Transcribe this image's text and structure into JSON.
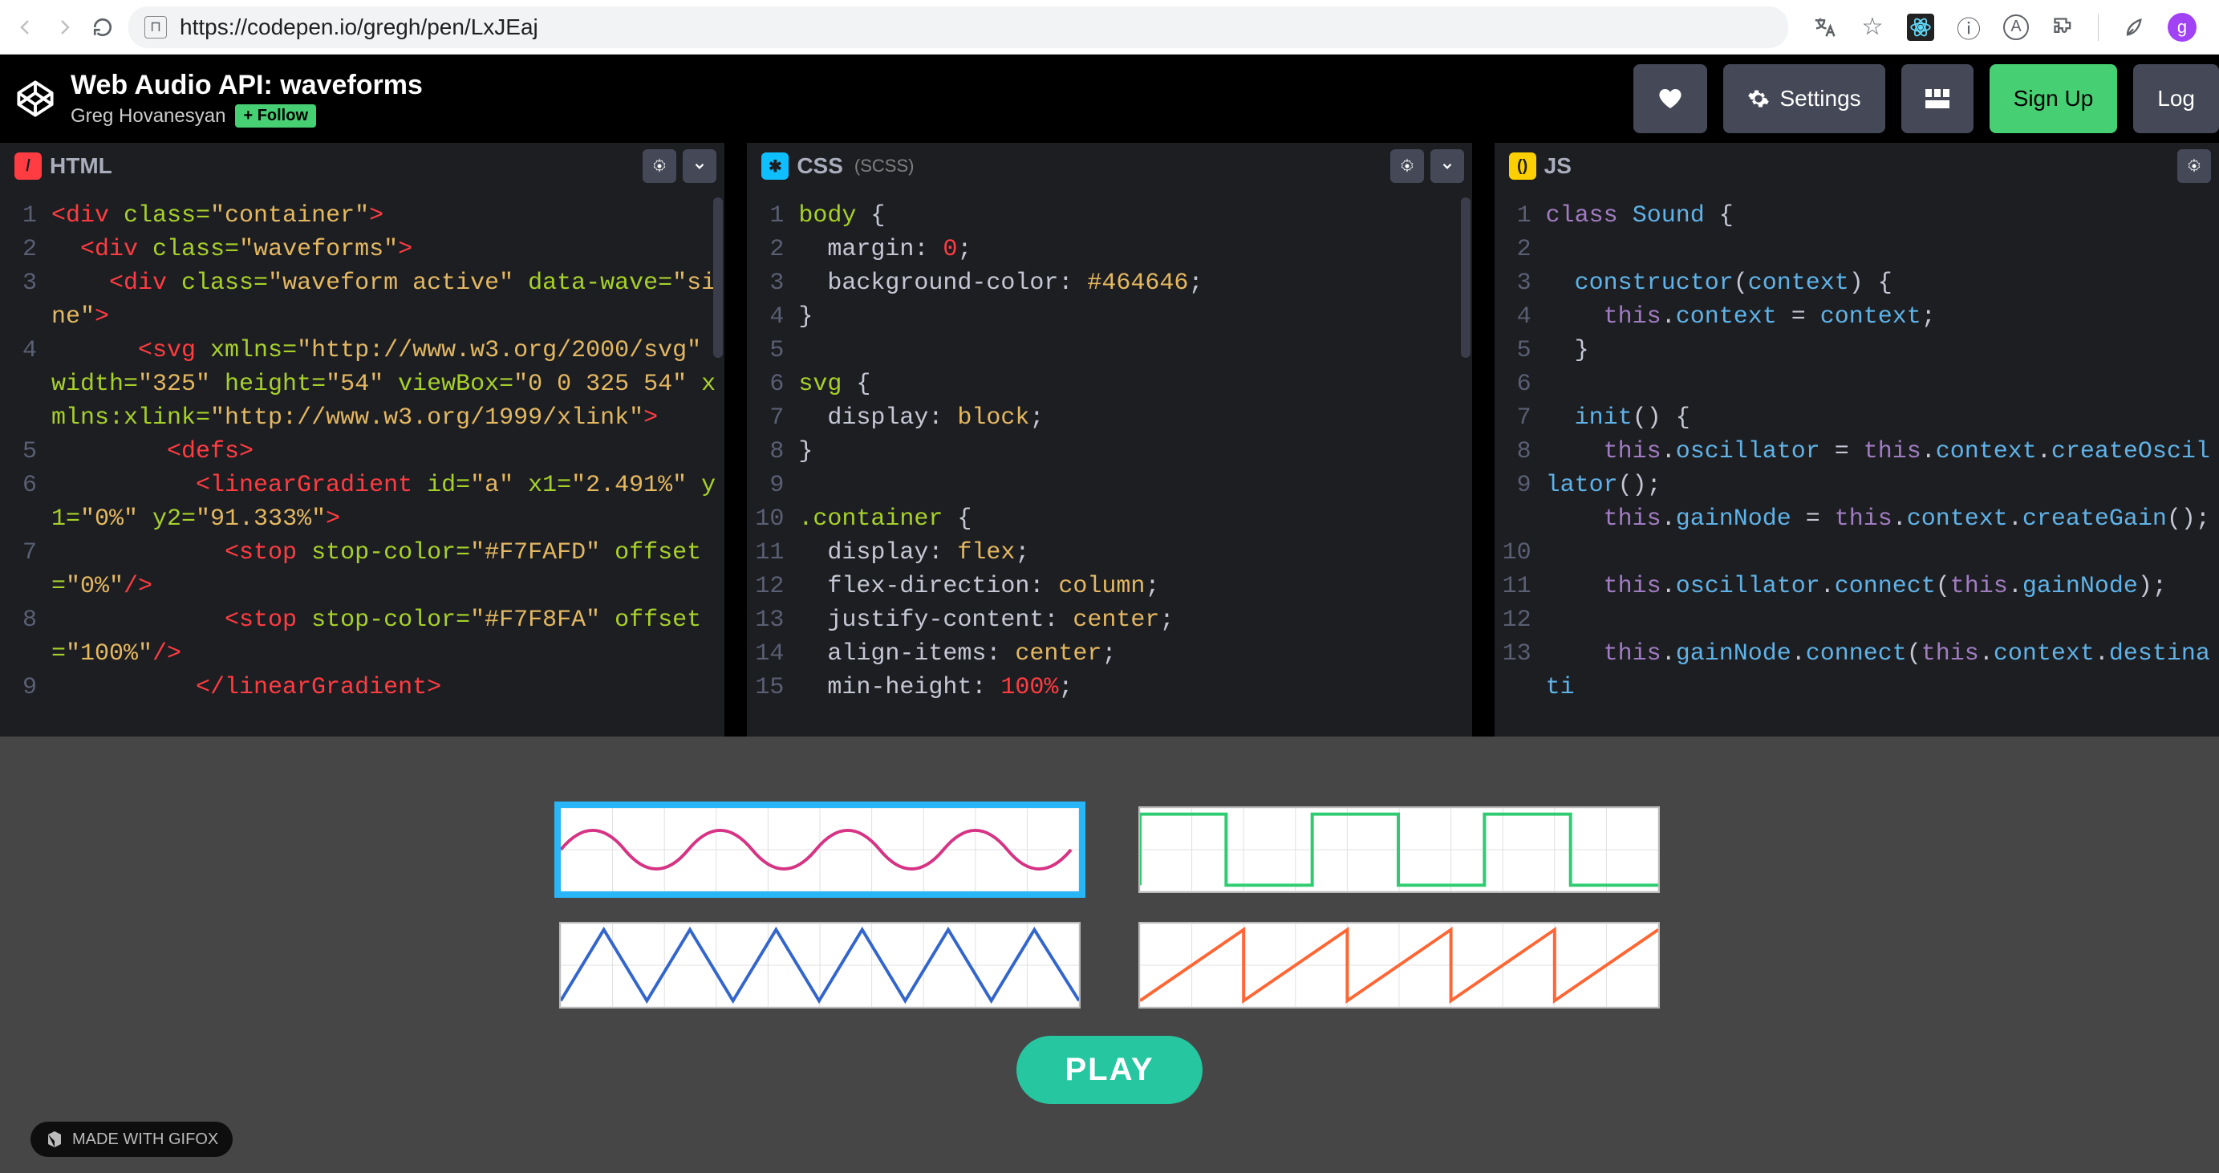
{
  "browser": {
    "url": "https://codepen.io/gregh/pen/LxJEaj",
    "avatar_initial": "g",
    "icons": [
      "translate-icon",
      "star-icon",
      "react-devtools-icon",
      "info-icon",
      "font-icon",
      "extensions-icon",
      "divider",
      "leaf-icon"
    ]
  },
  "header": {
    "title": "Web Audio API: waveforms",
    "author": "Greg Hovanesyan",
    "follow_label": "+ Follow",
    "settings_label": "Settings",
    "signup_label": "Sign Up",
    "login_label": "Log"
  },
  "editors": {
    "html": {
      "label": "HTML",
      "sublabel": "",
      "gutter": "1\n2\n3\n\n4\n\n\n5\n6\n\n7\n\n8\n\n9",
      "code_tokens": [
        [
          "tag",
          "<div"
        ],
        [
          "attr",
          " class="
        ],
        [
          "str",
          "\"container\""
        ],
        [
          "tag",
          ">"
        ],
        [
          "",
          "\n"
        ],
        [
          "",
          "  "
        ],
        [
          "tag",
          "<div"
        ],
        [
          "attr",
          " class="
        ],
        [
          "str",
          "\"waveforms\""
        ],
        [
          "tag",
          ">"
        ],
        [
          "",
          "\n"
        ],
        [
          "",
          "    "
        ],
        [
          "tag",
          "<div"
        ],
        [
          "attr",
          " class="
        ],
        [
          "str",
          "\"waveform active\""
        ],
        [
          "attr",
          " data-wave="
        ],
        [
          "str",
          "\"sine\""
        ],
        [
          "tag",
          ">"
        ],
        [
          "",
          "\n"
        ],
        [
          "",
          "      "
        ],
        [
          "tag",
          "<svg"
        ],
        [
          "attr",
          " xmlns="
        ],
        [
          "str",
          "\"http://www.w3.org/2000/svg\""
        ],
        [
          "attr",
          " width="
        ],
        [
          "str",
          "\"325\""
        ],
        [
          "attr",
          " height="
        ],
        [
          "str",
          "\"54\""
        ],
        [
          "attr",
          " viewBox="
        ],
        [
          "str",
          "\"0 0 325 54\""
        ],
        [
          "attr",
          " xmlns:xlink="
        ],
        [
          "str",
          "\"http://www.w3.org/1999/xlink\""
        ],
        [
          "tag",
          ">"
        ],
        [
          "",
          "\n"
        ],
        [
          "",
          "        "
        ],
        [
          "tag",
          "<defs>"
        ],
        [
          "",
          "\n"
        ],
        [
          "",
          "          "
        ],
        [
          "tag",
          "<linearGradient"
        ],
        [
          "attr",
          " id="
        ],
        [
          "str",
          "\"a\""
        ],
        [
          "attr",
          " x1="
        ],
        [
          "str",
          "\"2.491%\""
        ],
        [
          "attr",
          " y1="
        ],
        [
          "str",
          "\"0%\""
        ],
        [
          "attr",
          " y2="
        ],
        [
          "str",
          "\"91.333%\""
        ],
        [
          "tag",
          ">"
        ],
        [
          "",
          "\n"
        ],
        [
          "",
          "            "
        ],
        [
          "tag",
          "<stop"
        ],
        [
          "attr",
          " stop-color="
        ],
        [
          "str",
          "\"#F7FAFD\""
        ],
        [
          "attr",
          " offset="
        ],
        [
          "str",
          "\"0%\""
        ],
        [
          "tag",
          "/>"
        ],
        [
          "",
          "\n"
        ],
        [
          "",
          "            "
        ],
        [
          "tag",
          "<stop"
        ],
        [
          "attr",
          " stop-color="
        ],
        [
          "str",
          "\"#F7F8FA\""
        ],
        [
          "attr",
          " offset="
        ],
        [
          "str",
          "\"100%\""
        ],
        [
          "tag",
          "/>"
        ],
        [
          "",
          "\n"
        ],
        [
          "",
          "          "
        ],
        [
          "tag",
          "</linearGradient>"
        ]
      ]
    },
    "css": {
      "label": "CSS",
      "sublabel": "(SCSS)",
      "gutter": "1\n2\n3\n4\n5\n6\n7\n8\n9\n10\n11\n12\n13\n14\n15",
      "code_tokens": [
        [
          "sel",
          "body"
        ],
        [
          "",
          " {\n"
        ],
        [
          "",
          "  "
        ],
        [
          "prop",
          "margin"
        ],
        [
          "",
          ": "
        ],
        [
          "num",
          "0"
        ],
        [
          "",
          ";\n"
        ],
        [
          "",
          "  "
        ],
        [
          "prop",
          "background-color"
        ],
        [
          "",
          ": "
        ],
        [
          "val",
          "#464646"
        ],
        [
          "",
          ";\n"
        ],
        [
          "",
          "}\n\n"
        ],
        [
          "sel",
          "svg"
        ],
        [
          "",
          " {\n"
        ],
        [
          "",
          "  "
        ],
        [
          "prop",
          "display"
        ],
        [
          "",
          ": "
        ],
        [
          "val",
          "block"
        ],
        [
          "",
          ";\n"
        ],
        [
          "",
          "}\n\n"
        ],
        [
          "sel",
          ".container"
        ],
        [
          "",
          " {\n"
        ],
        [
          "",
          "  "
        ],
        [
          "prop",
          "display"
        ],
        [
          "",
          ": "
        ],
        [
          "val",
          "flex"
        ],
        [
          "",
          ";\n"
        ],
        [
          "",
          "  "
        ],
        [
          "prop",
          "flex-direction"
        ],
        [
          "",
          ": "
        ],
        [
          "val",
          "column"
        ],
        [
          "",
          ";\n"
        ],
        [
          "",
          "  "
        ],
        [
          "prop",
          "justify-content"
        ],
        [
          "",
          ": "
        ],
        [
          "val",
          "center"
        ],
        [
          "",
          ";\n"
        ],
        [
          "",
          "  "
        ],
        [
          "prop",
          "align-items"
        ],
        [
          "",
          ": "
        ],
        [
          "val",
          "center"
        ],
        [
          "",
          ";\n"
        ],
        [
          "",
          "  "
        ],
        [
          "prop",
          "min-height"
        ],
        [
          "",
          ": "
        ],
        [
          "num",
          "100%"
        ],
        [
          "",
          ";"
        ]
      ]
    },
    "js": {
      "label": "JS",
      "sublabel": "",
      "gutter": "1\n2\n3\n4\n5\n6\n7\n8\n9\n\n10\n11\n12\n13",
      "code_tokens": [
        [
          "kw",
          "class"
        ],
        [
          "",
          " "
        ],
        [
          "id",
          "Sound"
        ],
        [
          "",
          " {\n\n"
        ],
        [
          "",
          "  "
        ],
        [
          "fn",
          "constructor"
        ],
        [
          "",
          "("
        ],
        [
          "id",
          "context"
        ],
        [
          "",
          ") {\n"
        ],
        [
          "",
          "    "
        ],
        [
          "kw",
          "this"
        ],
        [
          "",
          "."
        ],
        [
          "id",
          "context"
        ],
        [
          "",
          " = "
        ],
        [
          "id",
          "context"
        ],
        [
          "",
          ";\n"
        ],
        [
          "",
          "  }\n\n"
        ],
        [
          "",
          "  "
        ],
        [
          "fn",
          "init"
        ],
        [
          "",
          "() {\n"
        ],
        [
          "",
          "    "
        ],
        [
          "kw",
          "this"
        ],
        [
          "",
          "."
        ],
        [
          "id",
          "oscillator"
        ],
        [
          "",
          " = "
        ],
        [
          "kw",
          "this"
        ],
        [
          "",
          "."
        ],
        [
          "id",
          "context"
        ],
        [
          "",
          "."
        ],
        [
          "fn",
          "createOscillator"
        ],
        [
          "",
          "();\n"
        ],
        [
          "",
          "    "
        ],
        [
          "kw",
          "this"
        ],
        [
          "",
          "."
        ],
        [
          "id",
          "gainNode"
        ],
        [
          "",
          " = "
        ],
        [
          "kw",
          "this"
        ],
        [
          "",
          "."
        ],
        [
          "id",
          "context"
        ],
        [
          "",
          "."
        ],
        [
          "fn",
          "createGain"
        ],
        [
          "",
          "();\n\n"
        ],
        [
          "",
          "    "
        ],
        [
          "kw",
          "this"
        ],
        [
          "",
          "."
        ],
        [
          "id",
          "oscillator"
        ],
        [
          "",
          "."
        ],
        [
          "fn",
          "connect"
        ],
        [
          "",
          "("
        ],
        [
          "kw",
          "this"
        ],
        [
          "",
          "."
        ],
        [
          "id",
          "gainNode"
        ],
        [
          "",
          ");\n\n"
        ],
        [
          "",
          "    "
        ],
        [
          "kw",
          "this"
        ],
        [
          "",
          "."
        ],
        [
          "id",
          "gainNode"
        ],
        [
          "",
          "."
        ],
        [
          "fn",
          "connect"
        ],
        [
          "",
          "("
        ],
        [
          "kw",
          "this"
        ],
        [
          "",
          "."
        ],
        [
          "id",
          "context"
        ],
        [
          "",
          "."
        ],
        [
          "id",
          "destinati"
        ]
      ]
    }
  },
  "preview": {
    "waveforms": [
      "sine",
      "square",
      "triangle",
      "sawtooth"
    ],
    "active_waveform": "sine",
    "play_label": "PLAY",
    "gifox_label": "MADE WITH GIFOX"
  },
  "colors": {
    "bg_editor": "#1d1e22",
    "bg_preview": "#464646",
    "accent_green": "#47cf73",
    "play_green": "#26c6a1",
    "active_outline": "#29b6f6",
    "sine_color": "#d63384",
    "square_color": "#2ecc71",
    "triangle_color": "#3366cc",
    "sawtooth_color": "#ff6633"
  }
}
